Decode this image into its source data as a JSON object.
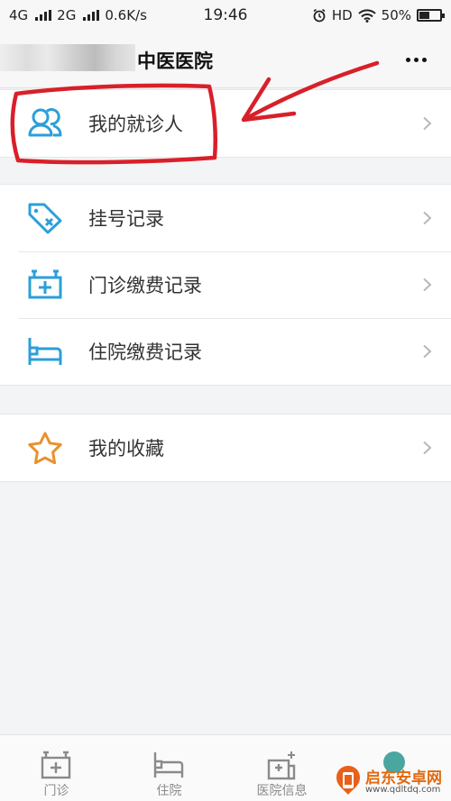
{
  "status_bar": {
    "net1": "4G",
    "net2": "2G",
    "speed": "0.6K/s",
    "time": "19:46",
    "hd": "HD",
    "battery": "50%",
    "battery_level": 0.5
  },
  "header": {
    "title": "中医医院",
    "more_icon": "more-dots-icon"
  },
  "menu": {
    "patients": {
      "label": "我的就诊人",
      "icon": "patients-icon"
    },
    "registration": {
      "label": "挂号记录",
      "icon": "ticket-icon"
    },
    "outpatient_payment": {
      "label": "门诊缴费记录",
      "icon": "medical-kit-icon"
    },
    "inpatient_payment": {
      "label": "住院缴费记录",
      "icon": "bed-icon"
    },
    "favorites": {
      "label": "我的收藏",
      "icon": "star-icon"
    }
  },
  "tabs": [
    {
      "label": "门诊",
      "icon": "medical-kit-icon"
    },
    {
      "label": "住院",
      "icon": "bed-icon"
    },
    {
      "label": "医院信息",
      "icon": "hospital-icon"
    },
    {
      "label": "",
      "icon": "profile-icon"
    }
  ],
  "watermark": {
    "name": "启东安卓网",
    "url": "www.qdltdq.com"
  },
  "colors": {
    "accent_blue": "#2b9fd9",
    "star_orange": "#e8912d",
    "annotation_red": "#d8202a"
  }
}
